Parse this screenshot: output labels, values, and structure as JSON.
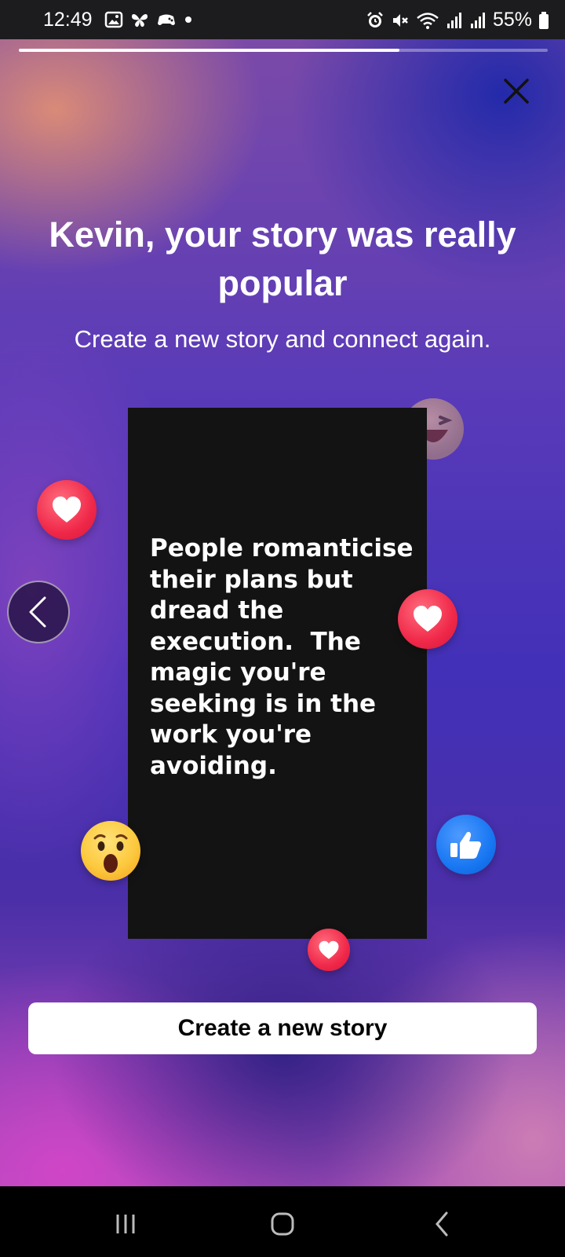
{
  "status_bar": {
    "time": "12:49",
    "battery": "55%",
    "left_icons": [
      "gallery-icon",
      "butterfly-icon",
      "game-icon",
      "dot-icon"
    ],
    "right_icons": [
      "alarm-icon",
      "mute-icon",
      "wifi-icon",
      "signal-icon",
      "signal-icon",
      "battery-icon"
    ]
  },
  "story": {
    "progress": 0.72,
    "headline": "Kevin, your story was really popular",
    "subline": "Create a new story and connect again.",
    "card_text": "People romanticise their plans but dread the execution.  The magic you're seeking is in the work you're avoiding.",
    "reactions": [
      "haha-emoji",
      "heart-emoji",
      "heart-emoji",
      "wow-emoji",
      "like-emoji",
      "heart-emoji"
    ]
  },
  "cta": {
    "label": "Create a new story"
  },
  "navigation": {
    "recent": "recent-apps-icon",
    "home": "home-icon",
    "back": "back-icon"
  },
  "colors": {
    "heart": "#f02849",
    "like": "#1877f2",
    "button_bg": "#ffffff",
    "card_bg": "#131313"
  }
}
